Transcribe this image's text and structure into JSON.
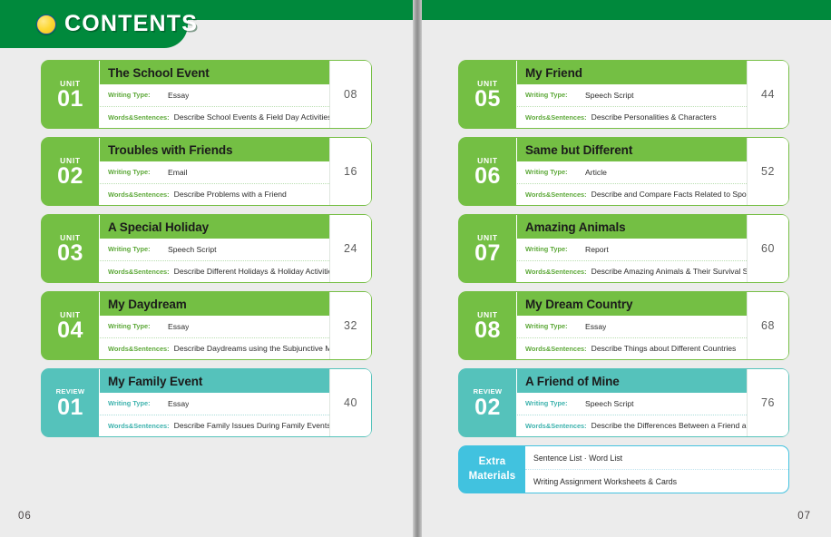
{
  "header": {
    "title": "CONTENTS",
    "icon": "sun-circle-icon"
  },
  "labels": {
    "writing_type": "Writing Type:",
    "words_sentences": "Words&Sentences:"
  },
  "colors": {
    "band_green": "#00893c",
    "unit_green": "#74bf44",
    "review_teal": "#55c2bb",
    "extra_cyan": "#41c2df",
    "page_bg": "#ececec"
  },
  "left_column": [
    {
      "kind": "UNIT",
      "number": "01",
      "theme": "green",
      "title": "The School Event",
      "writing_type": "Essay",
      "words_sentences": "Describe School Events & Field Day Activities",
      "page": "08"
    },
    {
      "kind": "UNIT",
      "number": "02",
      "theme": "green",
      "title": "Troubles with Friends",
      "writing_type": "Email",
      "words_sentences": "Describe Problems with a Friend",
      "page": "16"
    },
    {
      "kind": "UNIT",
      "number": "03",
      "theme": "green",
      "title": "A Special Holiday",
      "writing_type": "Speech Script",
      "words_sentences": "Describe Different Holidays & Holiday Activities",
      "page": "24"
    },
    {
      "kind": "UNIT",
      "number": "04",
      "theme": "green",
      "title": "My Daydream",
      "writing_type": "Essay",
      "words_sentences": "Describe Daydreams using the Subjunctive Mood",
      "page": "32"
    },
    {
      "kind": "REVIEW",
      "number": "01",
      "theme": "teal",
      "title": "My Family Event",
      "writing_type": "Essay",
      "words_sentences": "Describe Family Issues During Family Events",
      "page": "40"
    }
  ],
  "right_column": [
    {
      "kind": "UNIT",
      "number": "05",
      "theme": "green",
      "title": "My Friend",
      "writing_type": "Speech Script",
      "words_sentences": "Describe Personalities & Characters",
      "page": "44"
    },
    {
      "kind": "UNIT",
      "number": "06",
      "theme": "green",
      "title": "Same but Different",
      "writing_type": "Article",
      "words_sentences": "Describe and Compare Facts Related to Sports",
      "page": "52"
    },
    {
      "kind": "UNIT",
      "number": "07",
      "theme": "green",
      "title": "Amazing Animals",
      "writing_type": "Report",
      "words_sentences": "Describe Amazing Animals & Their Survival Skills",
      "page": "60"
    },
    {
      "kind": "UNIT",
      "number": "08",
      "theme": "green",
      "title": "My Dream Country",
      "writing_type": "Essay",
      "words_sentences": "Describe Things about Different Countries",
      "page": "68"
    },
    {
      "kind": "REVIEW",
      "number": "02",
      "theme": "teal",
      "title": "A Friend of Mine",
      "writing_type": "Speech Script",
      "words_sentences": "Describe the Differences Between a Friend and Me",
      "page": "76"
    }
  ],
  "extra_materials": {
    "badge_line1": "Extra",
    "badge_line2": "Materials",
    "row1": "Sentence List · Word List",
    "row2": "Writing Assignment Worksheets & Cards"
  },
  "folios": {
    "left": "06",
    "right": "07"
  }
}
